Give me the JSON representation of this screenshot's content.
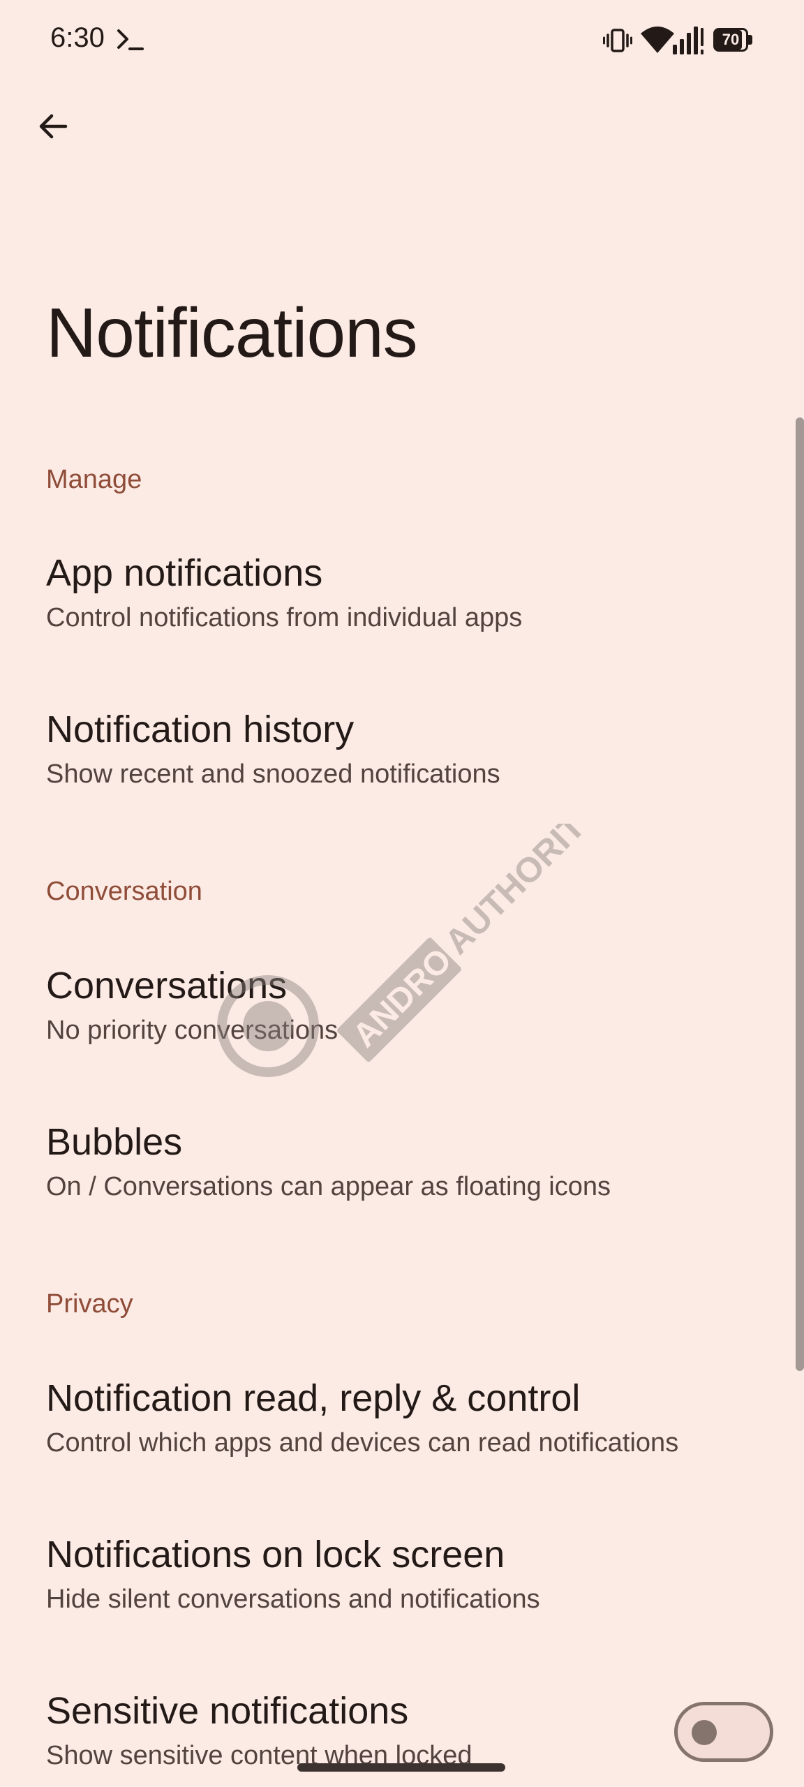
{
  "status_bar": {
    "time": "6:30",
    "battery_level": "70",
    "icons": [
      "terminal-icon",
      "vibrate-icon",
      "wifi-icon",
      "signal-icon",
      "battery-icon"
    ]
  },
  "header": {
    "back_icon": "arrow-back-icon",
    "title": "Notifications"
  },
  "sections": {
    "manage": {
      "label": "Manage",
      "items": [
        {
          "title": "App notifications",
          "subtitle": "Control notifications from individual apps"
        },
        {
          "title": "Notification history",
          "subtitle": "Show recent and snoozed notifications"
        }
      ]
    },
    "conversation": {
      "label": "Conversation",
      "items": [
        {
          "title": "Conversations",
          "subtitle": "No priority conversations"
        },
        {
          "title": "Bubbles",
          "subtitle": "On / Conversations can appear as floating icons"
        }
      ]
    },
    "privacy": {
      "label": "Privacy",
      "items": [
        {
          "title": "Notification read, reply & control",
          "subtitle": "Control which apps and devices can read notifications"
        },
        {
          "title": "Notifications on lock screen",
          "subtitle": "Hide silent conversations and notifications"
        },
        {
          "title": "Sensitive notifications",
          "subtitle": "Show sensitive content when locked",
          "toggle_on": false
        }
      ]
    }
  },
  "watermark": "ANDROID AUTHORITY",
  "colors": {
    "background": "#fcebe5",
    "accent": "#8f4c38",
    "text_primary": "#231a17",
    "text_secondary": "#53433f"
  }
}
